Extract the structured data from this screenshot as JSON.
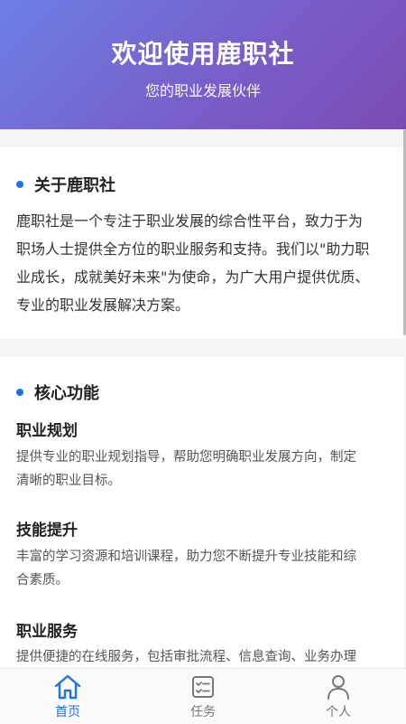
{
  "header": {
    "title": "欢迎使用鹿职社",
    "subtitle": "您的职业发展伙伴"
  },
  "about": {
    "title": "关于鹿职社",
    "lines": [
      "鹿职社是一个专注于职业发展的综合性平台，致力于为",
      "职场人士提供全方位的职业服务和支持。我们以\"助力职",
      "业成长，成就美好未来\"为使命，为广大用户提供优质、",
      "专业的职业发展解决方案。"
    ]
  },
  "core": {
    "title": "核心功能",
    "features": [
      {
        "title": "职业规划",
        "lines": [
          "提供专业的职业规划指导，帮助您明确职业发展方向，制定",
          "清晰的职业目标。"
        ]
      },
      {
        "title": "技能提升",
        "lines": [
          "丰富的学习资源和培训课程，助力您不断提升专业技能和综",
          "合素质。"
        ]
      },
      {
        "title": "职业服务",
        "lines": [
          "提供便捷的在线服务，包括审批流程、信息查询、业务办理"
        ]
      }
    ]
  },
  "tabs": [
    {
      "label": "首页",
      "icon": "home-icon",
      "active": true
    },
    {
      "label": "任务",
      "icon": "task-list-icon",
      "active": false
    },
    {
      "label": "个人",
      "icon": "person-icon",
      "active": false
    }
  ],
  "colors": {
    "accent": "#1a73e8",
    "header_gradient_start": "#6c7fe6",
    "header_gradient_end": "#7b4bb4"
  }
}
